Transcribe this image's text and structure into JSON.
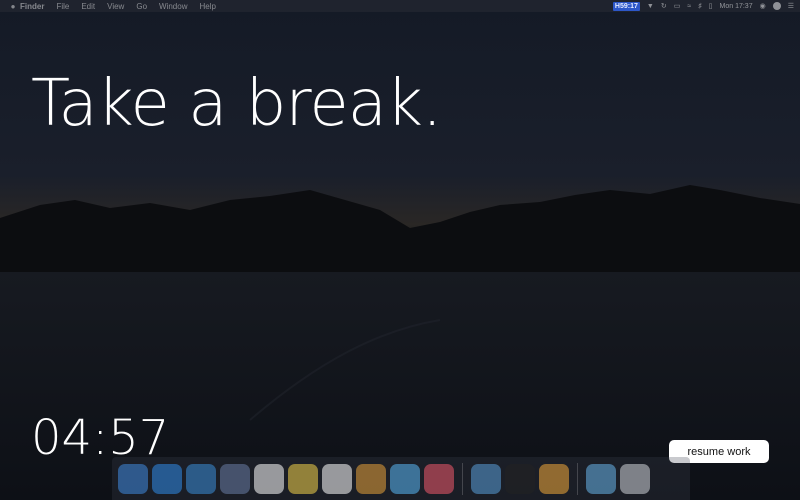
{
  "menubar": {
    "apple_icon": "apple-icon",
    "items": [
      "Finder",
      "File",
      "Edit",
      "View",
      "Go",
      "Window",
      "Help"
    ],
    "timer_badge": "H59:17",
    "clock": "Mon 17:37",
    "status_icons": [
      "shield-icon",
      "refresh-icon",
      "display-icon",
      "wifi-icon",
      "volume-icon",
      "battery-icon",
      "user-icon",
      "siri-icon",
      "list-icon"
    ]
  },
  "break": {
    "headline": "Take a break.",
    "countdown": "04:57",
    "resume_label": "resume work"
  },
  "dock": {
    "apps": [
      {
        "name": "finder-icon",
        "color": "#3f8be0"
      },
      {
        "name": "app-store-icon",
        "color": "#2f8de9"
      },
      {
        "name": "safari-icon",
        "color": "#3b8ed8"
      },
      {
        "name": "preview-icon",
        "color": "#6a7ea6"
      },
      {
        "name": "calendar-icon",
        "color": "#ffffff"
      },
      {
        "name": "notes-icon",
        "color": "#f4d44a"
      },
      {
        "name": "reminders-icon",
        "color": "#ffffff"
      },
      {
        "name": "photos-icon",
        "color": "#e8a33a"
      },
      {
        "name": "messages-icon",
        "color": "#5ab8f5"
      },
      {
        "name": "music-icon",
        "color": "#f05a6b"
      },
      {
        "name": "xcode-icon",
        "color": "#5a9ed8"
      },
      {
        "name": "terminal-icon",
        "color": "#222222"
      },
      {
        "name": "sketch-icon",
        "color": "#f2a93b"
      },
      {
        "name": "downloads-folder-icon",
        "color": "#67b4ea"
      },
      {
        "name": "trash-icon",
        "color": "#cfd3d8"
      }
    ]
  }
}
